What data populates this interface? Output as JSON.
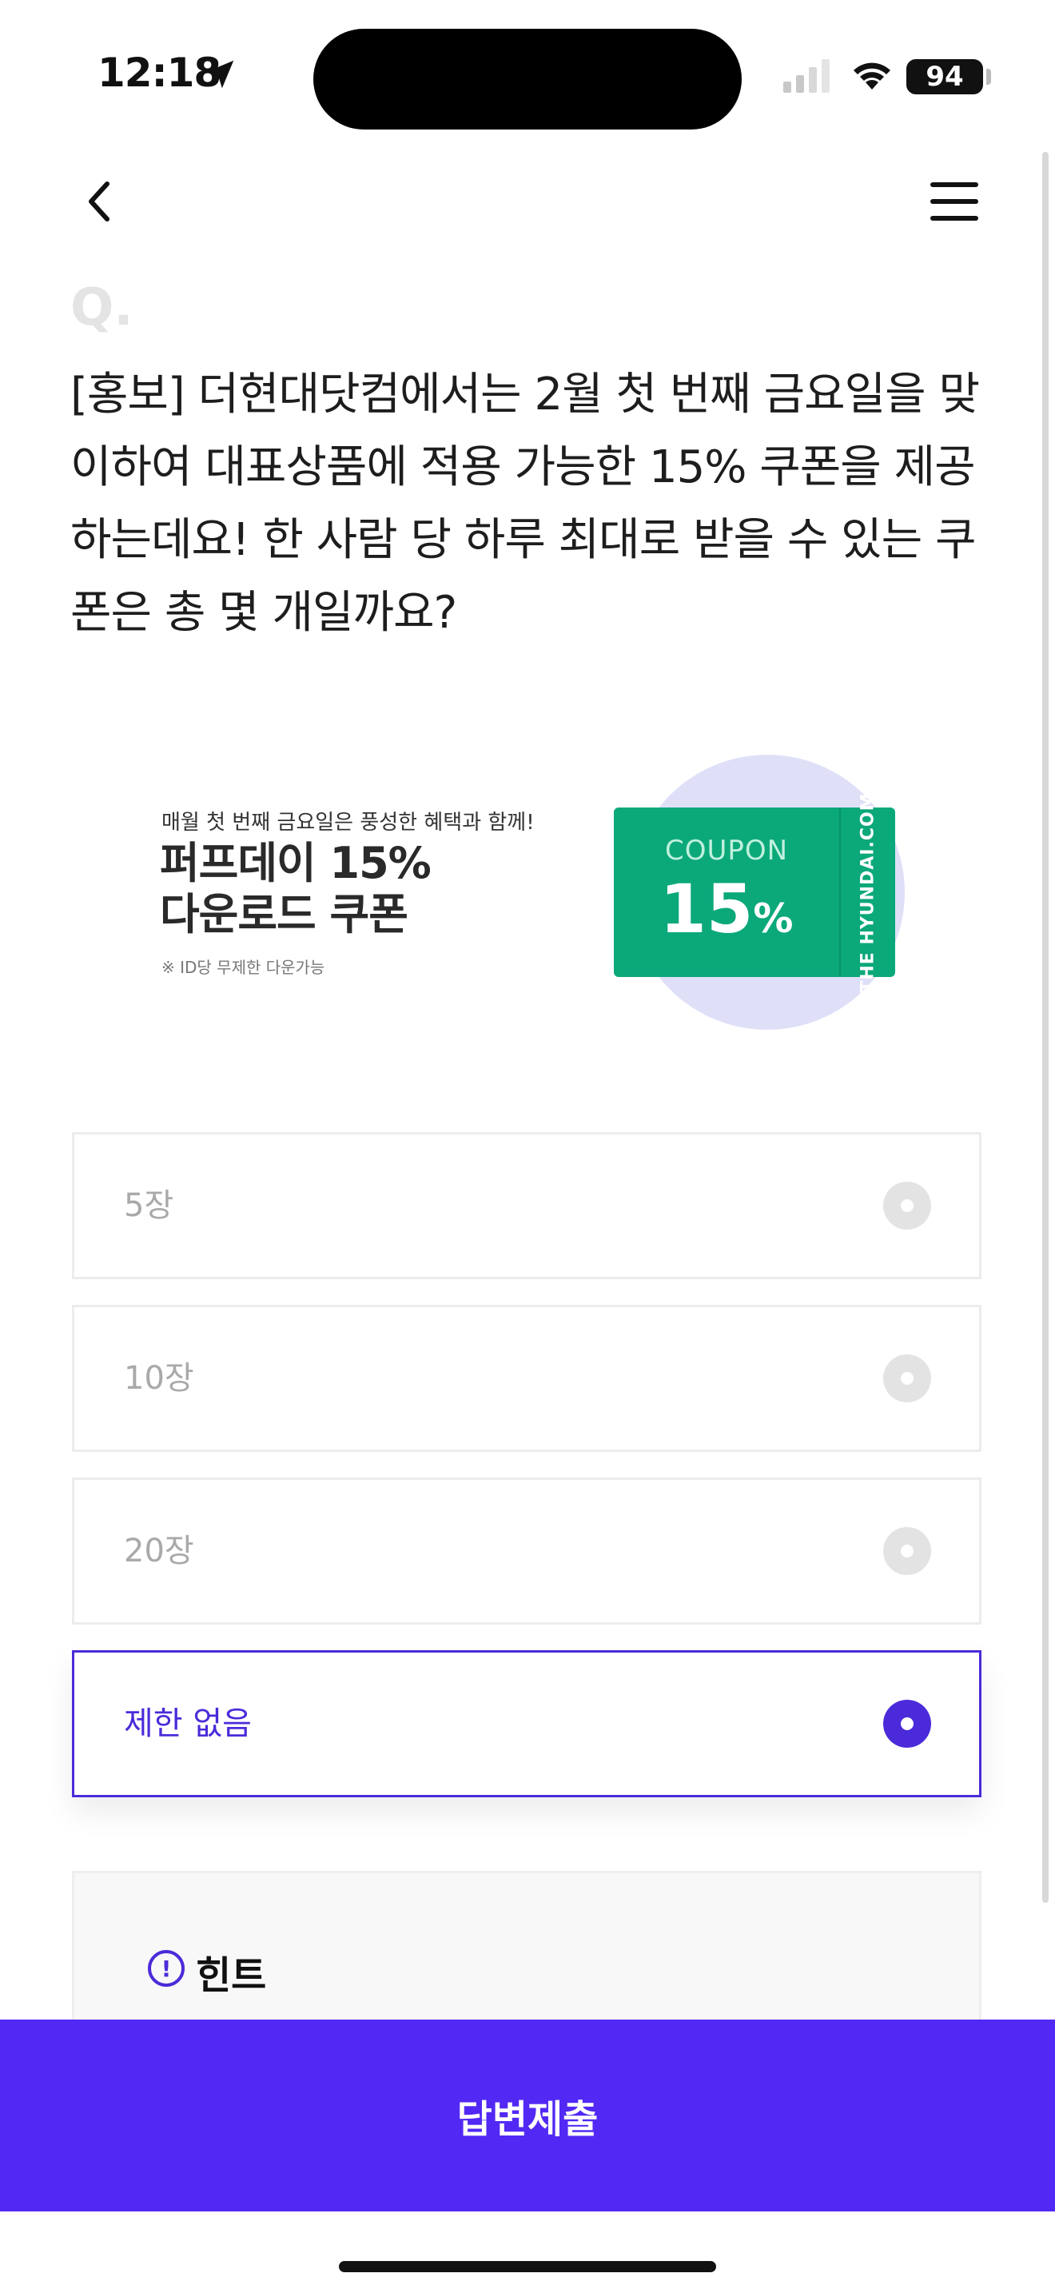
{
  "status": {
    "time": "12:18",
    "battery": "94"
  },
  "question": {
    "marker": "Q.",
    "text": "[홍보] 더현대닷컴에서는 2월 첫 번째 금요일을 맞이하여 대표상품에 적용 가능한 15% 쿠폰을 제공하는데요! 한 사람 당 하루 최대로 받을 수 있는 쿠폰은 총 몇 개일까요?"
  },
  "banner": {
    "subtitle": "매월 첫 번째 금요일은 풍성한 혜택과 함께!",
    "title_line1": "퍼프데이 15%",
    "title_line2": "다운로드 쿠폰",
    "note": "※ ID당 무제한 다운가능",
    "coupon_label": "COUPON",
    "coupon_value": "15",
    "coupon_unit": "%",
    "coupon_brand": "THE HYUNDAI.COM"
  },
  "options": [
    {
      "label": "5장",
      "selected": false
    },
    {
      "label": "10장",
      "selected": false
    },
    {
      "label": "20장",
      "selected": false
    },
    {
      "label": "제한 없음",
      "selected": true
    }
  ],
  "hint": {
    "icon": "!",
    "label": "힌트"
  },
  "submit": {
    "label": "답변제출"
  },
  "colors": {
    "accent": "#5229f4",
    "coupon_green": "#0ba87a"
  }
}
